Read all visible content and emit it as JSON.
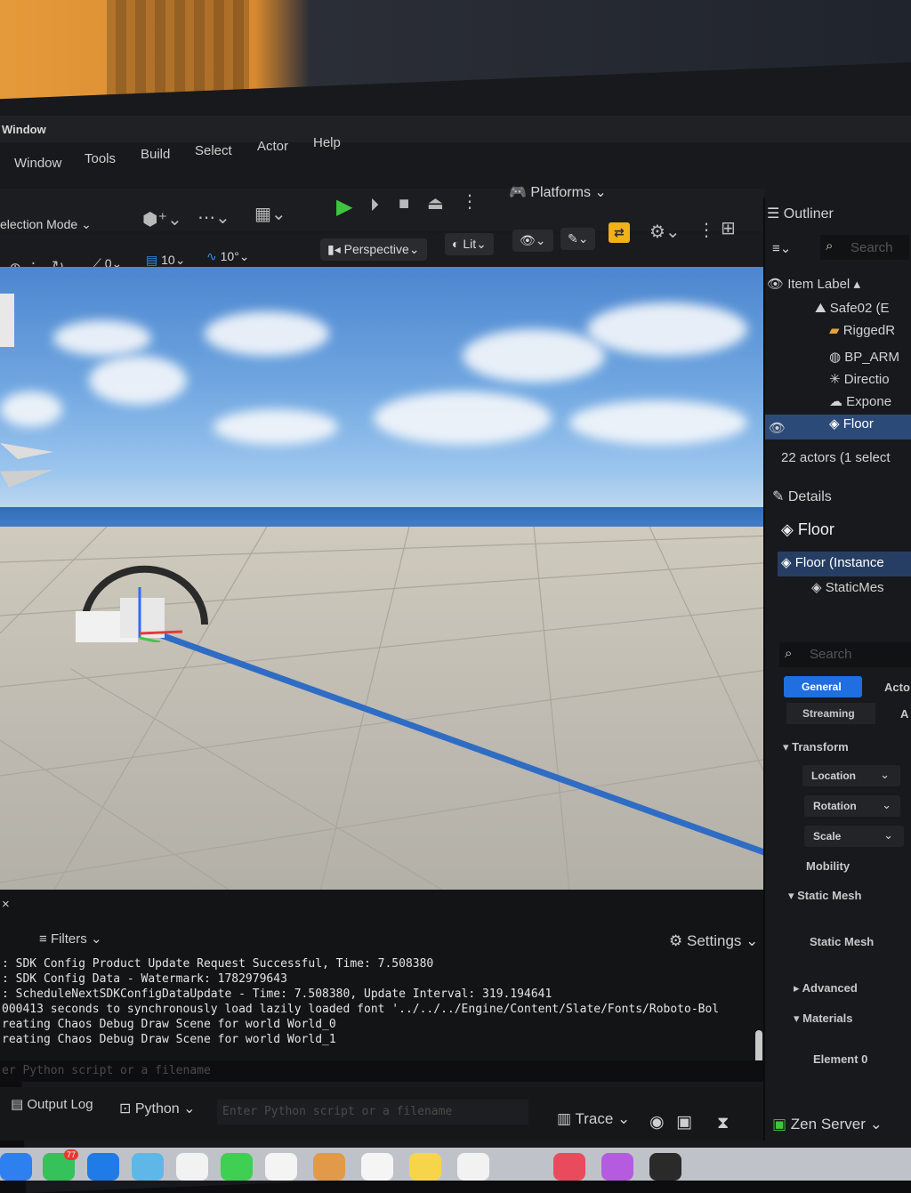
{
  "window": {
    "title": "Window"
  },
  "menu": {
    "items": [
      "Window",
      "Tools",
      "Build",
      "Select",
      "Actor",
      "Help"
    ]
  },
  "toolbar": {
    "selection_mode": "election Mode",
    "platforms": "Platforms"
  },
  "viewport_toolbar": {
    "rotation_snap": "0",
    "grid_snap": "10",
    "angle_snap": "10°",
    "view_mode": "Perspective",
    "lighting": "Lit"
  },
  "outliner": {
    "title": "Outliner",
    "search_placeholder": "Search",
    "column_label": "Item Label",
    "items": [
      "Safe02 (E",
      "RiggedR",
      "BP_ARM",
      "Directio",
      "Expone",
      "Floor"
    ],
    "count": "22 actors (1 select"
  },
  "details": {
    "title": "Details",
    "actor_name": "Floor",
    "component_root": "Floor (Instance",
    "component_child": "StaticMes",
    "search_placeholder": "Search",
    "tabs": [
      "General",
      "Acto",
      "Streaming",
      "A"
    ],
    "sections": {
      "transform": "Transform",
      "location": "Location",
      "rotation": "Rotation",
      "scale": "Scale",
      "mobility": "Mobility",
      "static_mesh_section": "Static Mesh",
      "static_mesh_prop": "Static Mesh",
      "advanced": "Advanced",
      "materials": "Materials",
      "element0": "Element 0"
    }
  },
  "console": {
    "filters": "Filters",
    "settings": "Settings",
    "lines": [
      ": SDK Config Product Update Request Successful, Time: 7.508380",
      ": SDK Config Data - Watermark: 1782979643",
      ": ScheduleNextSDKConfigDataUpdate - Time: 7.508380, Update Interval: 319.194641",
      "000413 seconds to synchronously load lazily loaded font '../../../Engine/Content/Slate/Fonts/Roboto-Bol",
      "reating Chaos Debug Draw Scene for world World_0",
      "reating Chaos Debug Draw Scene for world World_1"
    ],
    "input_placeholder": "er Python script or a filename"
  },
  "statusbar": {
    "output_log": "Output Log",
    "python": "Python",
    "python_input_placeholder": "Enter Python script or a filename",
    "trace": "Trace",
    "zen_server": "Zen Server"
  },
  "dock": {
    "mail_badge": "77"
  },
  "colors": {
    "accent": "#1f6fe0",
    "play_green": "#3ec43e",
    "snap_orange": "#f2b119",
    "selection": "#2c4a78"
  }
}
